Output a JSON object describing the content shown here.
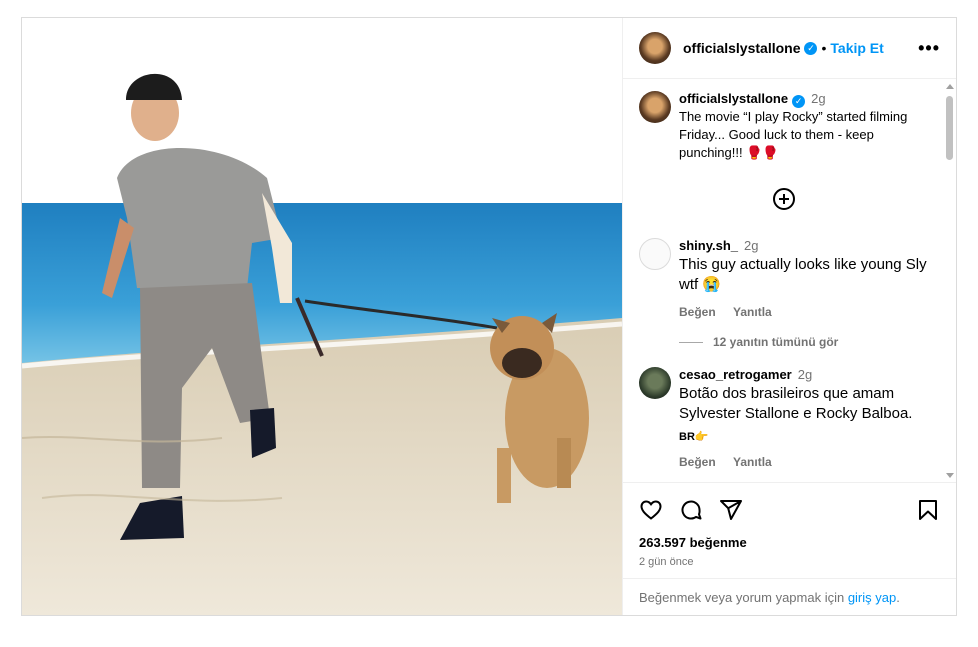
{
  "post": {
    "username": "officialslystallone",
    "follow_label": "Takip Et",
    "more_label": "•••",
    "verified_mark": "✓"
  },
  "caption": {
    "username": "officialslystallone",
    "time": "2g",
    "text": "The movie “I play Rocky” started filming Friday... Good luck to them - keep punching!!! 🥊🥊"
  },
  "comments": [
    {
      "username": "shiny.sh_",
      "time": "2g",
      "text": "This guy actually looks like young Sly wtf 😭",
      "like_label": "Beğen",
      "reply_label": "Yanıtla"
    },
    {
      "username": "cesao_retrogamer",
      "time": "2g",
      "text": "Botão dos brasileiros que amam Sylvester Stallone e Rocky Balboa.",
      "tag": "BR👉",
      "like_label": "Beğen",
      "reply_label": "Yanıtla"
    }
  ],
  "replies_link": "12 yanıtın tümünü gör",
  "likes": "263.597 beğenme",
  "posted_ago": "2 gün önce",
  "login_prompt": {
    "text": "Beğenmek veya yorum yapmak için ",
    "link": "giriş yap",
    "suffix": "."
  },
  "icons": {
    "like": "heart-icon",
    "comment": "comment-icon",
    "share": "share-icon",
    "save": "bookmark-icon",
    "add_comment": "plus-circle-icon"
  },
  "colors": {
    "link_blue": "#0095f6",
    "muted": "#737373",
    "border": "#dbdbdb"
  }
}
